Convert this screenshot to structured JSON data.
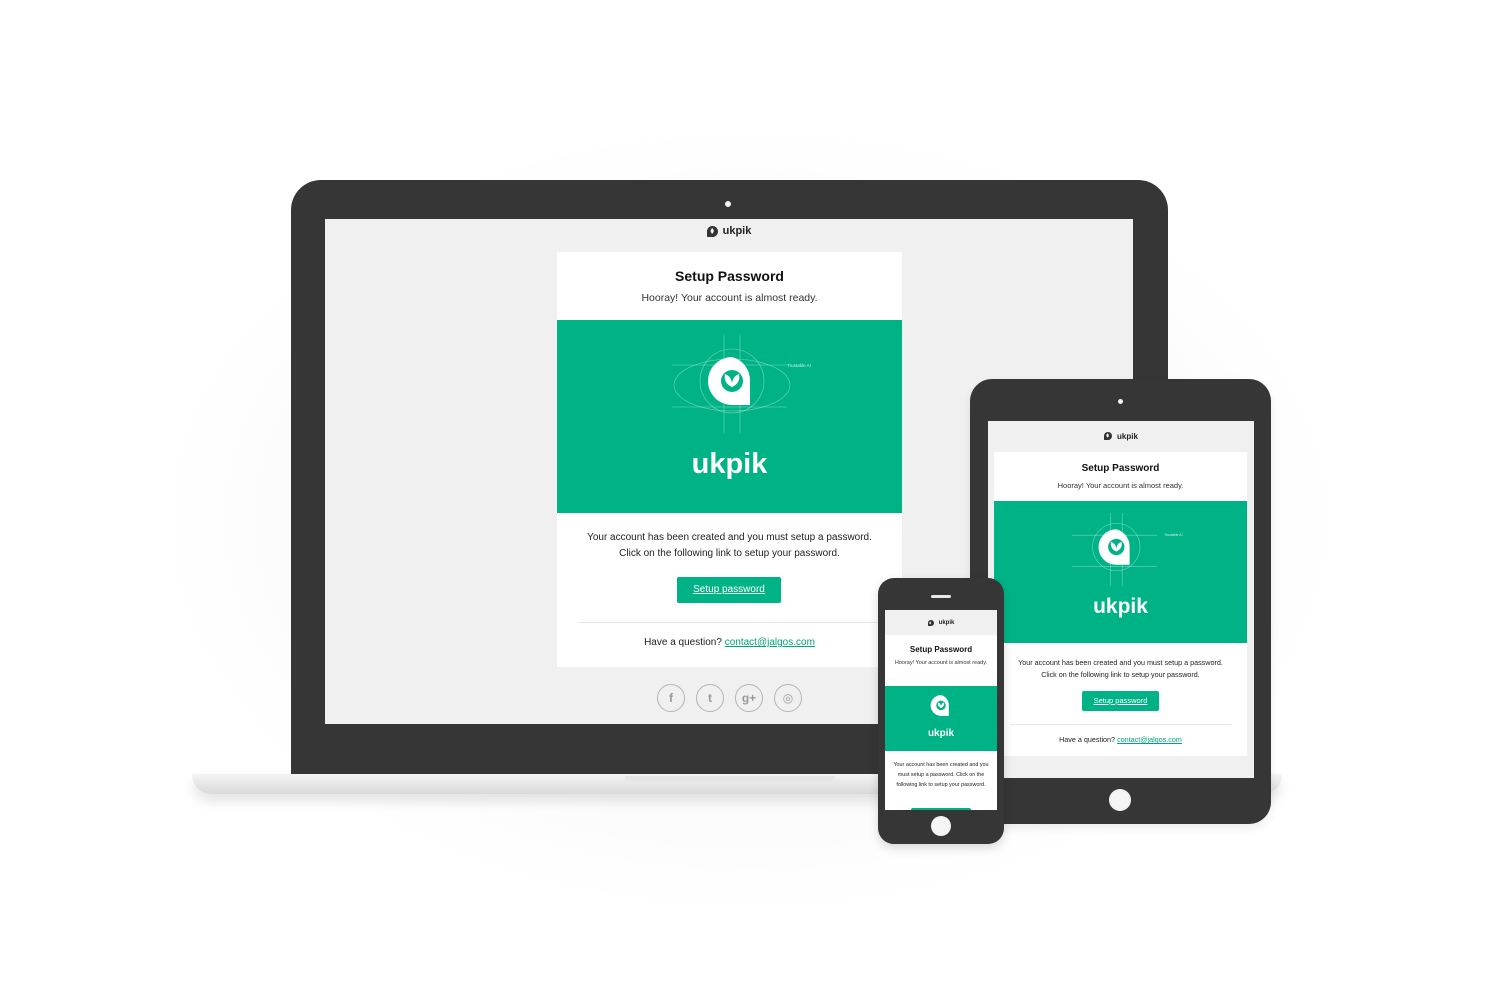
{
  "brand": {
    "name": "ukpik",
    "hero_wordmark": "ukpik",
    "hero_tag": "Trustable AI",
    "accent_color": "#00b386"
  },
  "email": {
    "title": "Setup Password",
    "subtitle": "Hooray! Your account is almost ready.",
    "body_line1": "Your account has been created and you must setup a password.",
    "body_line2": "Click on the following link to setup your password.",
    "phone_body": "Your account has been created and you must setup a password. Click on the following link to setup your password.",
    "cta_label": "Setup password",
    "question_label": "Have a question?",
    "contact_email": "contact@jalgos.com"
  },
  "social": [
    {
      "name": "facebook-icon",
      "glyph": "f"
    },
    {
      "name": "twitter-icon",
      "glyph": "t"
    },
    {
      "name": "google-plus-icon",
      "glyph": "g+"
    },
    {
      "name": "instagram-icon",
      "glyph": "◎"
    }
  ]
}
